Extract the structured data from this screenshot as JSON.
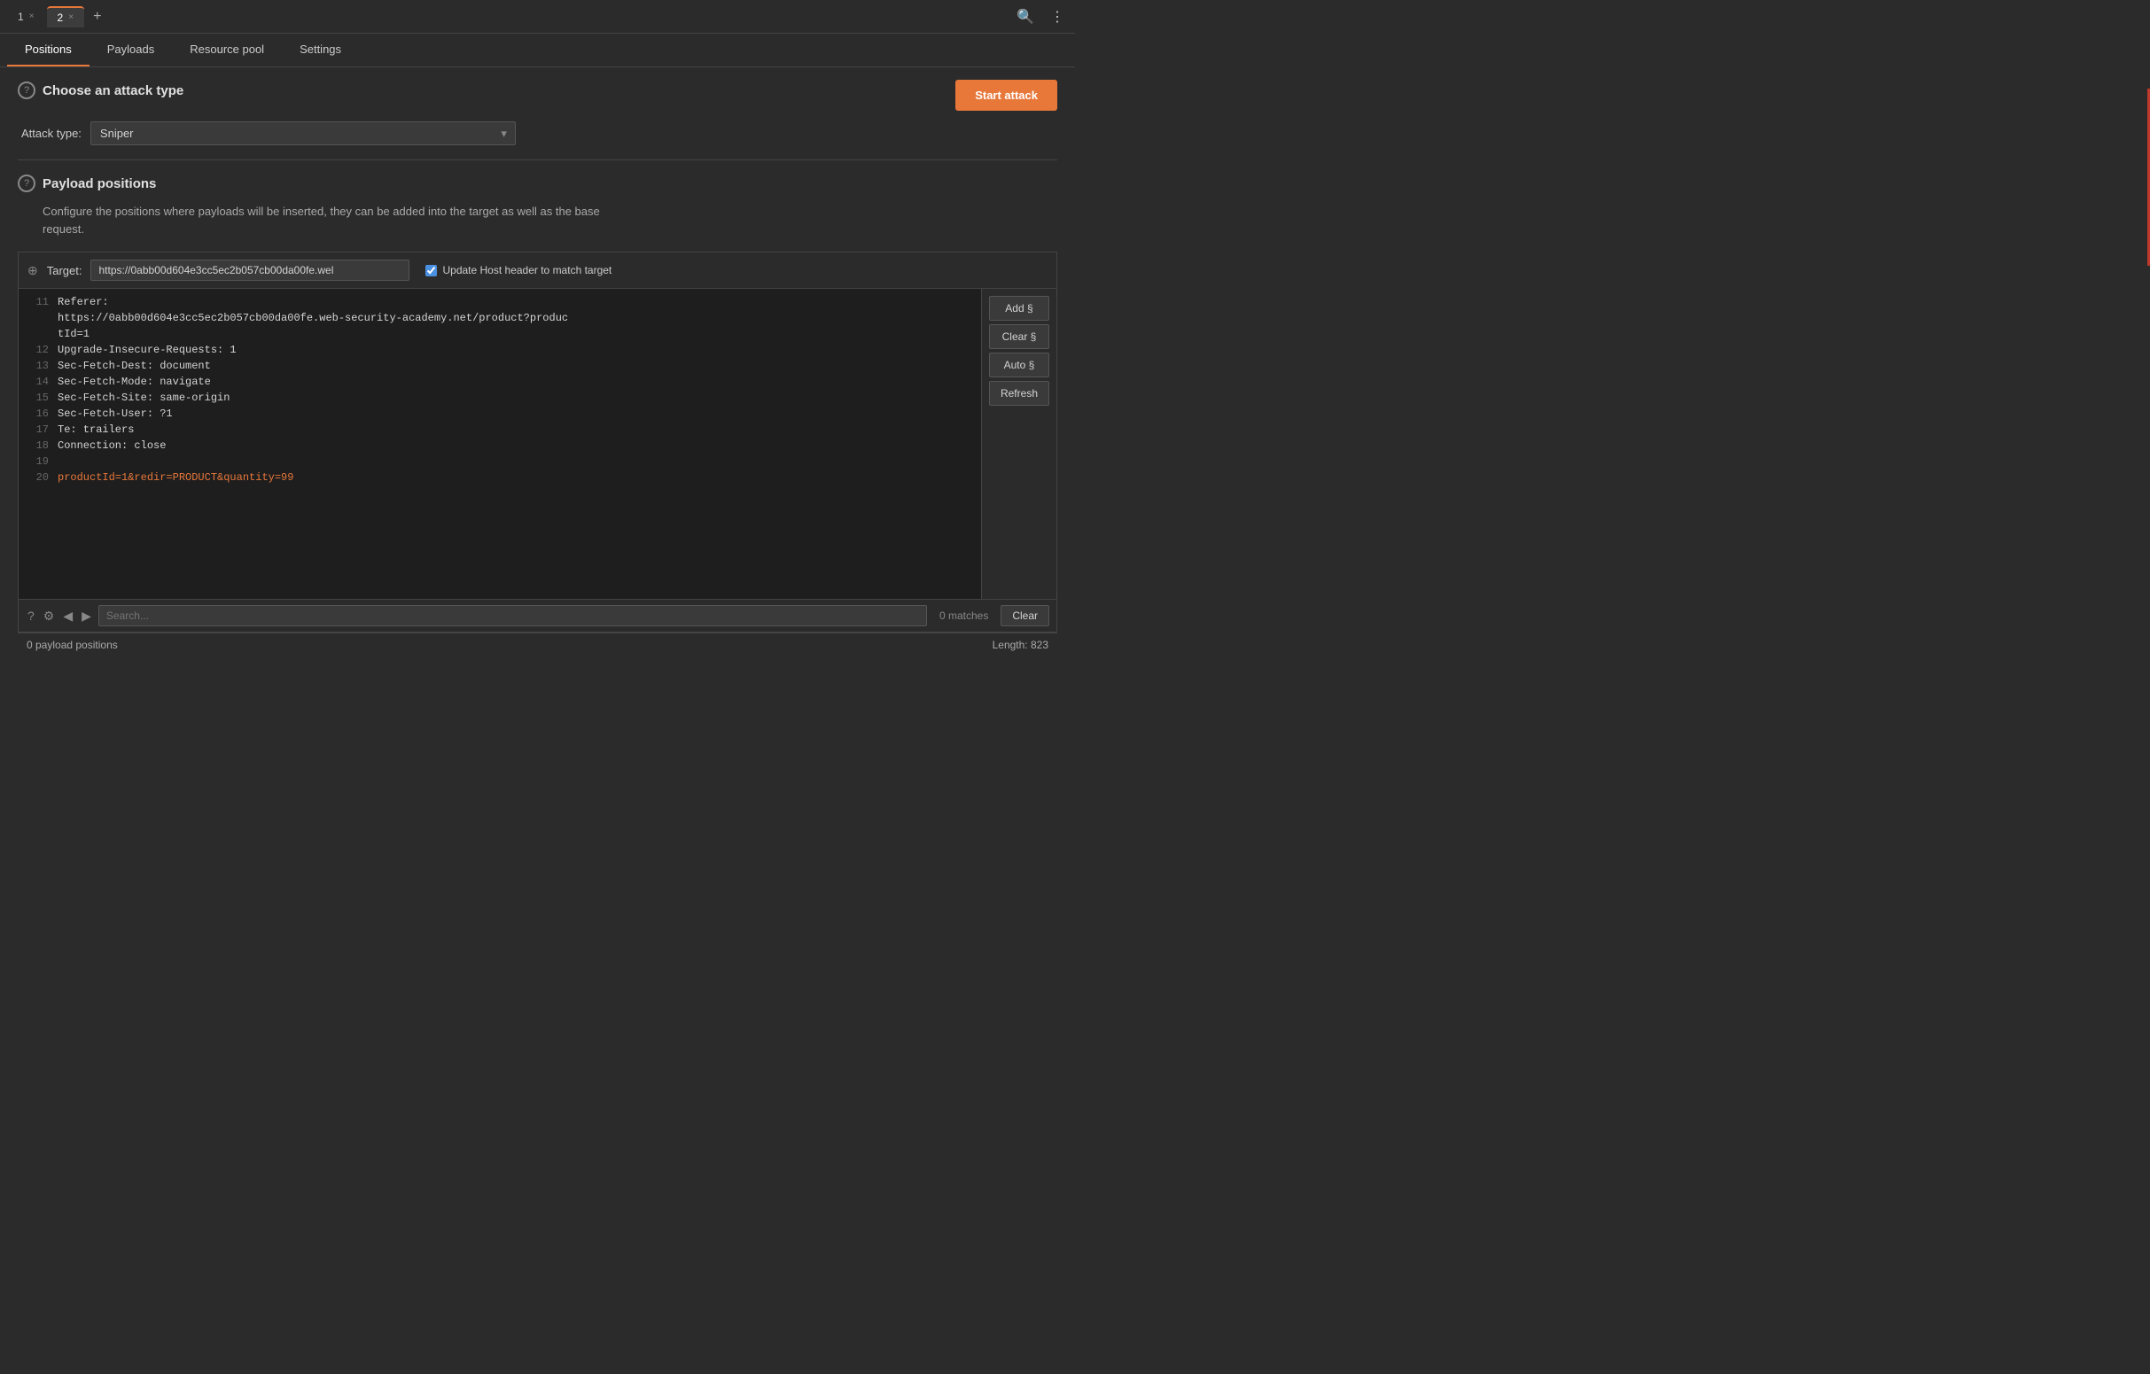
{
  "tabs": [
    {
      "id": "1",
      "label": "1",
      "active": false
    },
    {
      "id": "2",
      "label": "2",
      "active": true
    }
  ],
  "navTabs": [
    {
      "id": "positions",
      "label": "Positions",
      "active": true
    },
    {
      "id": "payloads",
      "label": "Payloads",
      "active": false
    },
    {
      "id": "resource_pool",
      "label": "Resource pool",
      "active": false
    },
    {
      "id": "settings",
      "label": "Settings",
      "active": false
    }
  ],
  "attackSection": {
    "title": "Choose an attack type",
    "startButton": "Start attack",
    "attackTypeLabel": "Attack type:",
    "attackTypeValue": "Sniper"
  },
  "positionsSection": {
    "title": "Payload positions",
    "description": "Configure the positions where payloads will be inserted, they can be added into the target as well as the base\nrequest.",
    "targetLabel": "Target:",
    "targetUrl": "https://0abb00d604e3cc5ec2b057cb00da00fe.wel",
    "updateHostLabel": "Update Host header to match target",
    "sideButtons": {
      "add": "Add §",
      "clear": "Clear §",
      "auto": "Auto §",
      "refresh": "Refresh"
    },
    "codeLines": [
      {
        "num": "11",
        "content": "Referer:",
        "highlight": false
      },
      {
        "num": "",
        "content": "https://0abb00d604e3cc5ec2b057cb00da00fe.web-security-academy.net/product?produc",
        "highlight": false
      },
      {
        "num": "",
        "content": "tId=1",
        "highlight": false
      },
      {
        "num": "12",
        "content": "Upgrade-Insecure-Requests: 1",
        "highlight": false
      },
      {
        "num": "13",
        "content": "Sec-Fetch-Dest: document",
        "highlight": false
      },
      {
        "num": "14",
        "content": "Sec-Fetch-Mode: navigate",
        "highlight": false
      },
      {
        "num": "15",
        "content": "Sec-Fetch-Site: same-origin",
        "highlight": false
      },
      {
        "num": "16",
        "content": "Sec-Fetch-User: ?1",
        "highlight": false
      },
      {
        "num": "17",
        "content": "Te: trailers",
        "highlight": false
      },
      {
        "num": "18",
        "content": "Connection: close",
        "highlight": false
      },
      {
        "num": "19",
        "content": "",
        "highlight": false
      },
      {
        "num": "20",
        "content": "productId=1&redir=PRODUCT&quantity=99",
        "highlight": true
      }
    ],
    "searchPlaceholder": "Search...",
    "matchesLabel": "0 matches",
    "clearLabel": "Clear",
    "statusLeft": "0 payload positions",
    "statusRight": "Length: 823"
  }
}
